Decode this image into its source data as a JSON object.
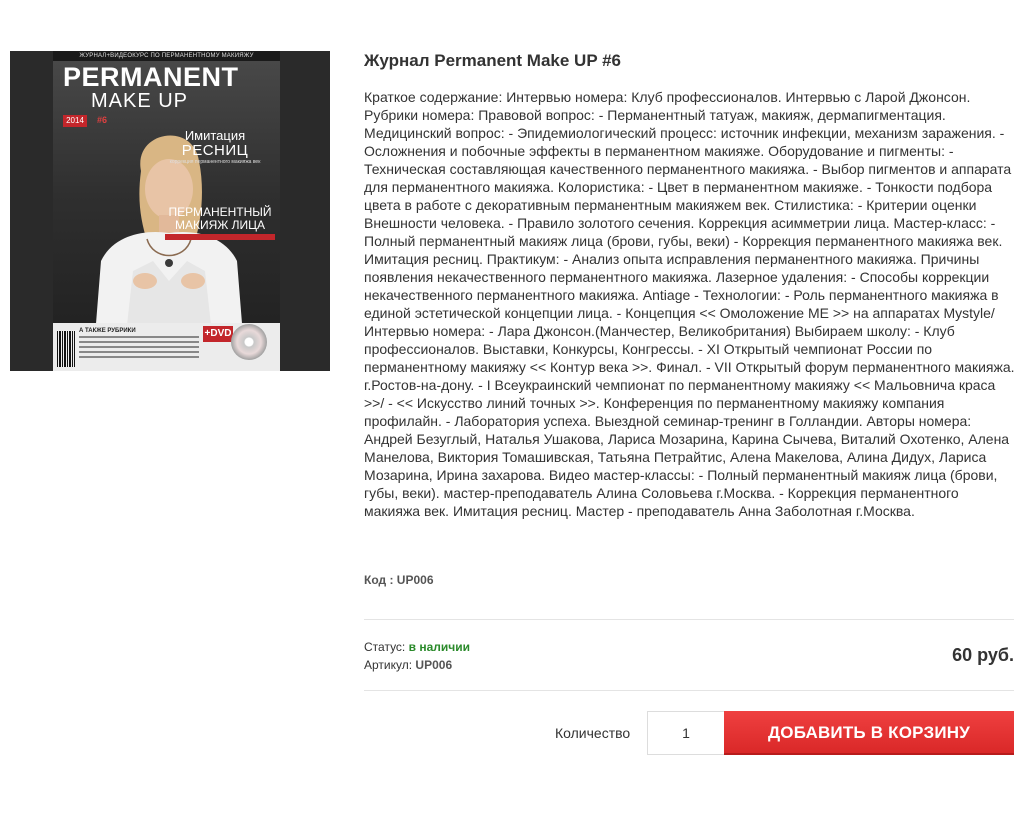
{
  "product": {
    "title": "Журнал Permanent Make UP #6",
    "description": "Краткое содержание: Интервью номера: Клуб профессионалов. Интервью с Ларой Джонсон. Рубрики номера: Правовой вопрос: - Перманентный татуаж, макияж, дермапигментация. Медицинский вопрос: - Эпидемиологический процесс: источник инфекции, механизм заражения. - Осложнения и побочные эффекты в перманентном макияже. Оборудование и пигменты: - Техническая составляющая качественного перманентного макияжа. - Выбор пигментов и аппарата для перманентного макияжа. Колористика: - Цвет в перманентном макияже. - Тонкости подбора цвета в работе с декоративным перманентным макияжем век. Стилистика: - Критерии оценки Внешности человека. - Правило золотого сечения. Коррекция асимметрии лица. Мастер-класс: - Полный перманентный макияж лица (брови, губы, веки) - Коррекция перманентного макияжа век. Имитация ресниц. Практикум: - Анализ опыта исправления перманентного макияжа. Причины появления некачественного перманентного макияжа. Лазерное удаления: - Способы коррекции некачественного перманентного макияжа. Antiage - Технологии: - Роль перманентного макияжа в единой эстетической концепции лица. - Концепция << Омоложение МЕ >> на аппаратах Mystyle/ Интервью номера: - Лара Джонсон.(Манчестер, Великобритания) Выбираем школу: - Клуб профессионалов. Выставки, Конкурсы, Конгрессы. - XI Открытый чемпионат России по перманентному макияжу << Контур века >>. Финал. - VII Открытый форум перманентного макияжа. г.Ростов-на-дону. - I Всеукраинский чемпионат по перманентному макияжу << Мальовнича краса >>/ - << Искусство линий точных >>. Конференция по перманентному макияжу компания профилайн. - Лаборатория успеха. Выездной семинар-тренинг в Голландии. Авторы номера: Андрей Безуглый, Наталья Ушакова, Лариса Мозарина, Карина Сычева, Виталий Охотенко, Алена Манелова, Виктория Томашивская, Татьяна Петрайтис, Алена Макелова, Алина Дидух, Лариса Мозарина, Ирина захарова. Видео мастер-классы: - Полный перманентный макияж лица (брови, губы, веки). мастер-преподаватель Алина Соловьева г.Москва. - Коррекция перманентного макияжа век. Имитация ресниц. Мастер - преподаватель Анна Заболотная г.Москва.",
    "code_label": "Код :",
    "code_value": "UP006",
    "status_label": "Статус:",
    "status_value": "в наличии",
    "sku_label": "Артикул:",
    "sku_value": "UP006",
    "price": "60 руб.",
    "quantity_label": "Количество",
    "quantity_value": "1",
    "add_to_cart_label": "ДОБАВИТЬ В КОРЗИНУ"
  },
  "cover": {
    "top_strip": "ЖУРНАЛ+ВИДЕОКУРС ПО ПЕРМАНЕНТНОМУ МАКИЯЖУ",
    "logo_main": "PERMANENT",
    "logo_sub": "MAKE UP",
    "year": "2014",
    "issue": "#6",
    "headline_1": "Имитация",
    "headline_2": "РЕСНИЦ",
    "headline_small": "коррекция перманентного макияжа век",
    "feature_1": "ПЕРМАНЕНТНЫЙ",
    "feature_2": "МАКИЯЖ ЛИЦА",
    "rubrics": "А ТАКЖЕ РУБРИКИ",
    "dvd": "+DVD"
  },
  "colors": {
    "accent_red": "#d92727",
    "status_green": "#2a8a2a"
  }
}
